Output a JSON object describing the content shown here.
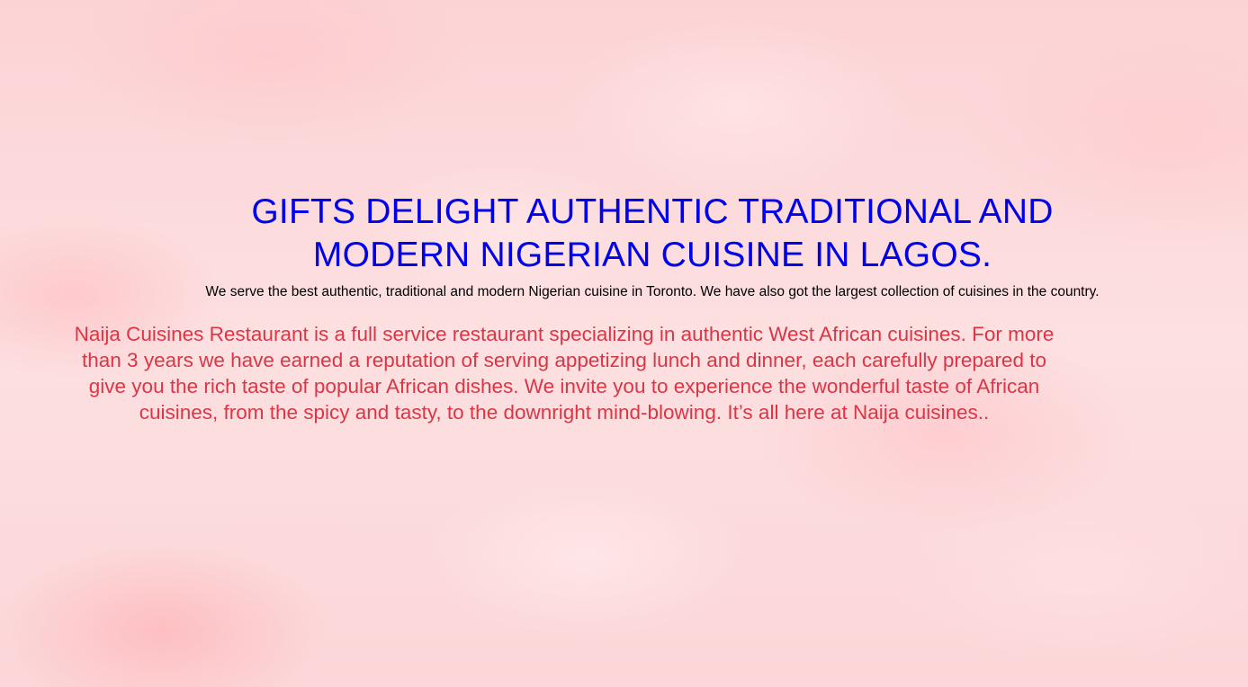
{
  "hero": {
    "title": "GIFTS DELIGHT AUTHENTIC TRADITIONAL AND MODERN NIGERIAN CUISINE IN LAGOS.",
    "subtitle": "We serve the best authentic, traditional and modern Nigerian cuisine in Toronto. We have also got the largest collection of cuisines in the country."
  },
  "about": {
    "text": "Naija Cuisines Restaurant is a full service restaurant specializing in authentic West African cuisines. For more than 3 years we have earned a reputation of serving appetizing lunch and dinner, each carefully prepared to give you the rich taste of popular African dishes. We invite you to experience the wonderful taste of African cuisines, from the spicy and tasty, to the downright mind-blowing. It’s all here at Naija cuisines.."
  },
  "colors": {
    "title": "#0000ee",
    "subtitle": "#000000",
    "about": "#dc3545",
    "background": "#fdd9da"
  }
}
